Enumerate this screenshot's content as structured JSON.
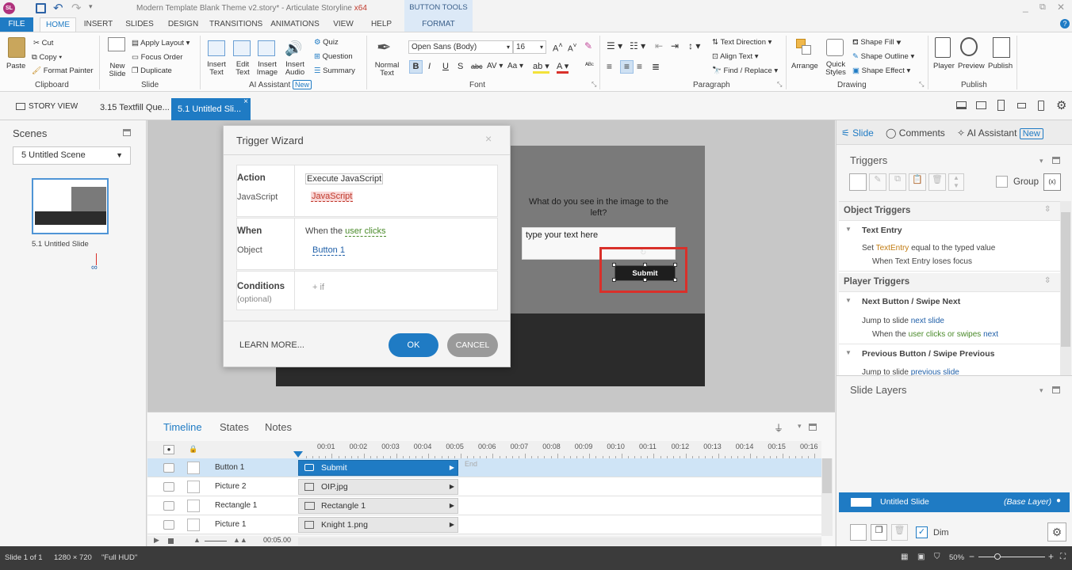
{
  "window": {
    "title": "Modern Template Blank Theme v2.story* - Articulate Storyline",
    "arch": "x64",
    "context_tab": "BUTTON TOOLS"
  },
  "ribbon_tabs": [
    "FILE",
    "HOME",
    "INSERT",
    "SLIDES",
    "DESIGN",
    "TRANSITIONS",
    "ANIMATIONS",
    "VIEW",
    "HELP",
    "FORMAT"
  ],
  "ribbon": {
    "clipboard": {
      "paste": "Paste",
      "cut": "Cut",
      "copy": "Copy",
      "format_painter": "Format Painter",
      "label": "Clipboard"
    },
    "slide": {
      "new_slide": "New Slide",
      "apply_layout": "Apply Layout",
      "focus_order": "Focus Order",
      "duplicate": "Duplicate",
      "label": "Slide"
    },
    "ai": {
      "insert_text": "Insert Text",
      "edit_text": "Edit Text",
      "insert_image": "Insert Image",
      "insert_audio": "Insert Audio",
      "quiz": "Quiz",
      "question": "Question",
      "summary": "Summary",
      "label": "AI Assistant",
      "badge": "New"
    },
    "font": {
      "normal_text": "Normal Text",
      "family": "Open Sans (Body)",
      "size": "16",
      "label": "Font"
    },
    "paragraph": {
      "text_direction": "Text Direction",
      "align_text": "Align Text",
      "find_replace": "Find / Replace",
      "label": "Paragraph"
    },
    "drawing": {
      "arrange": "Arrange",
      "quick_styles": "Quick Styles",
      "shape_fill": "Shape Fill",
      "shape_outline": "Shape Outline",
      "shape_effect": "Shape Effect",
      "label": "Drawing"
    },
    "publish": {
      "player": "Player",
      "preview": "Preview",
      "publish": "Publish",
      "label": "Publish"
    }
  },
  "doc_tabs": {
    "story_view": "STORY VIEW",
    "tab1": "3.15 Textfill Que...",
    "tab2": "5.1 Untitled Sli..."
  },
  "scenes": {
    "title": "Scenes",
    "selected": "5 Untitled Scene",
    "slide_label": "5.1 Untitled Slide"
  },
  "dialog": {
    "title": "Trigger Wizard",
    "action_label": "Action",
    "action_value": "Execute JavaScript",
    "js_label": "JavaScript",
    "js_value": "JavaScript",
    "when_label": "When",
    "when_prefix": "When the",
    "when_value": "user clicks",
    "object_label": "Object",
    "object_value": "Button 1",
    "cond_label": "Conditions",
    "cond_optional": "(optional)",
    "cond_add": "+ if",
    "learn_more": "LEARN MORE...",
    "ok": "OK",
    "cancel": "CANCEL"
  },
  "slide": {
    "question": "What do you see in the image to the left?",
    "placeholder": "type your text here",
    "submit": "Submit"
  },
  "right": {
    "tabs": {
      "slide": "Slide",
      "comments": "Comments",
      "ai": "AI Assistant",
      "ai_badge": "New"
    },
    "triggers_title": "Triggers",
    "group": "Group",
    "object_triggers": "Object Triggers",
    "text_entry": "Text Entry",
    "te_line1_pre": "Set",
    "te_line1_var": "TextEntry",
    "te_line1_post": "equal to the typed value",
    "te_line2": "When Text Entry loses focus",
    "player_triggers": "Player Triggers",
    "next_title": "Next Button / Swipe Next",
    "next_line1_pre": "Jump to slide",
    "next_line1_val": "next slide",
    "next_line2_pre": "When the",
    "next_line2_val": "user clicks or swipes",
    "next_line2_post": "next",
    "prev_title": "Previous Button / Swipe Previous",
    "prev_line1_pre": "Jump to slide",
    "prev_line1_val": "previous slide",
    "layers_title": "Slide Layers",
    "base_layer": "Untitled Slide",
    "base_tag": "(Base Layer)",
    "dim": "Dim"
  },
  "timeline": {
    "tabs": [
      "Timeline",
      "States",
      "Notes"
    ],
    "ticks": [
      "00:01",
      "00:02",
      "00:03",
      "00:04",
      "00:05",
      "00:06",
      "00:07",
      "00:08",
      "00:09",
      "00:10",
      "00:11",
      "00:12",
      "00:13",
      "00:14",
      "00:15",
      "00:16"
    ],
    "end_label": "End",
    "rows": [
      {
        "name": "Button 1",
        "bar": "Submit"
      },
      {
        "name": "Picture 2",
        "bar": "OIP.jpg"
      },
      {
        "name": "Rectangle 1",
        "bar": "Rectangle 1"
      },
      {
        "name": "Picture 1",
        "bar": "Knight 1.png"
      }
    ],
    "duration": "00:05.00"
  },
  "status": {
    "slide": "Slide 1 of 1",
    "size": "1280 × 720",
    "hud": "\"Full HUD\"",
    "zoom": "50%"
  },
  "colors": {
    "accent": "#1f7bc4",
    "selected_row": "#cfe4f6",
    "red_box": "#d9302a",
    "ok": "#1f7bc4",
    "cancel": "#9a9a9a"
  }
}
